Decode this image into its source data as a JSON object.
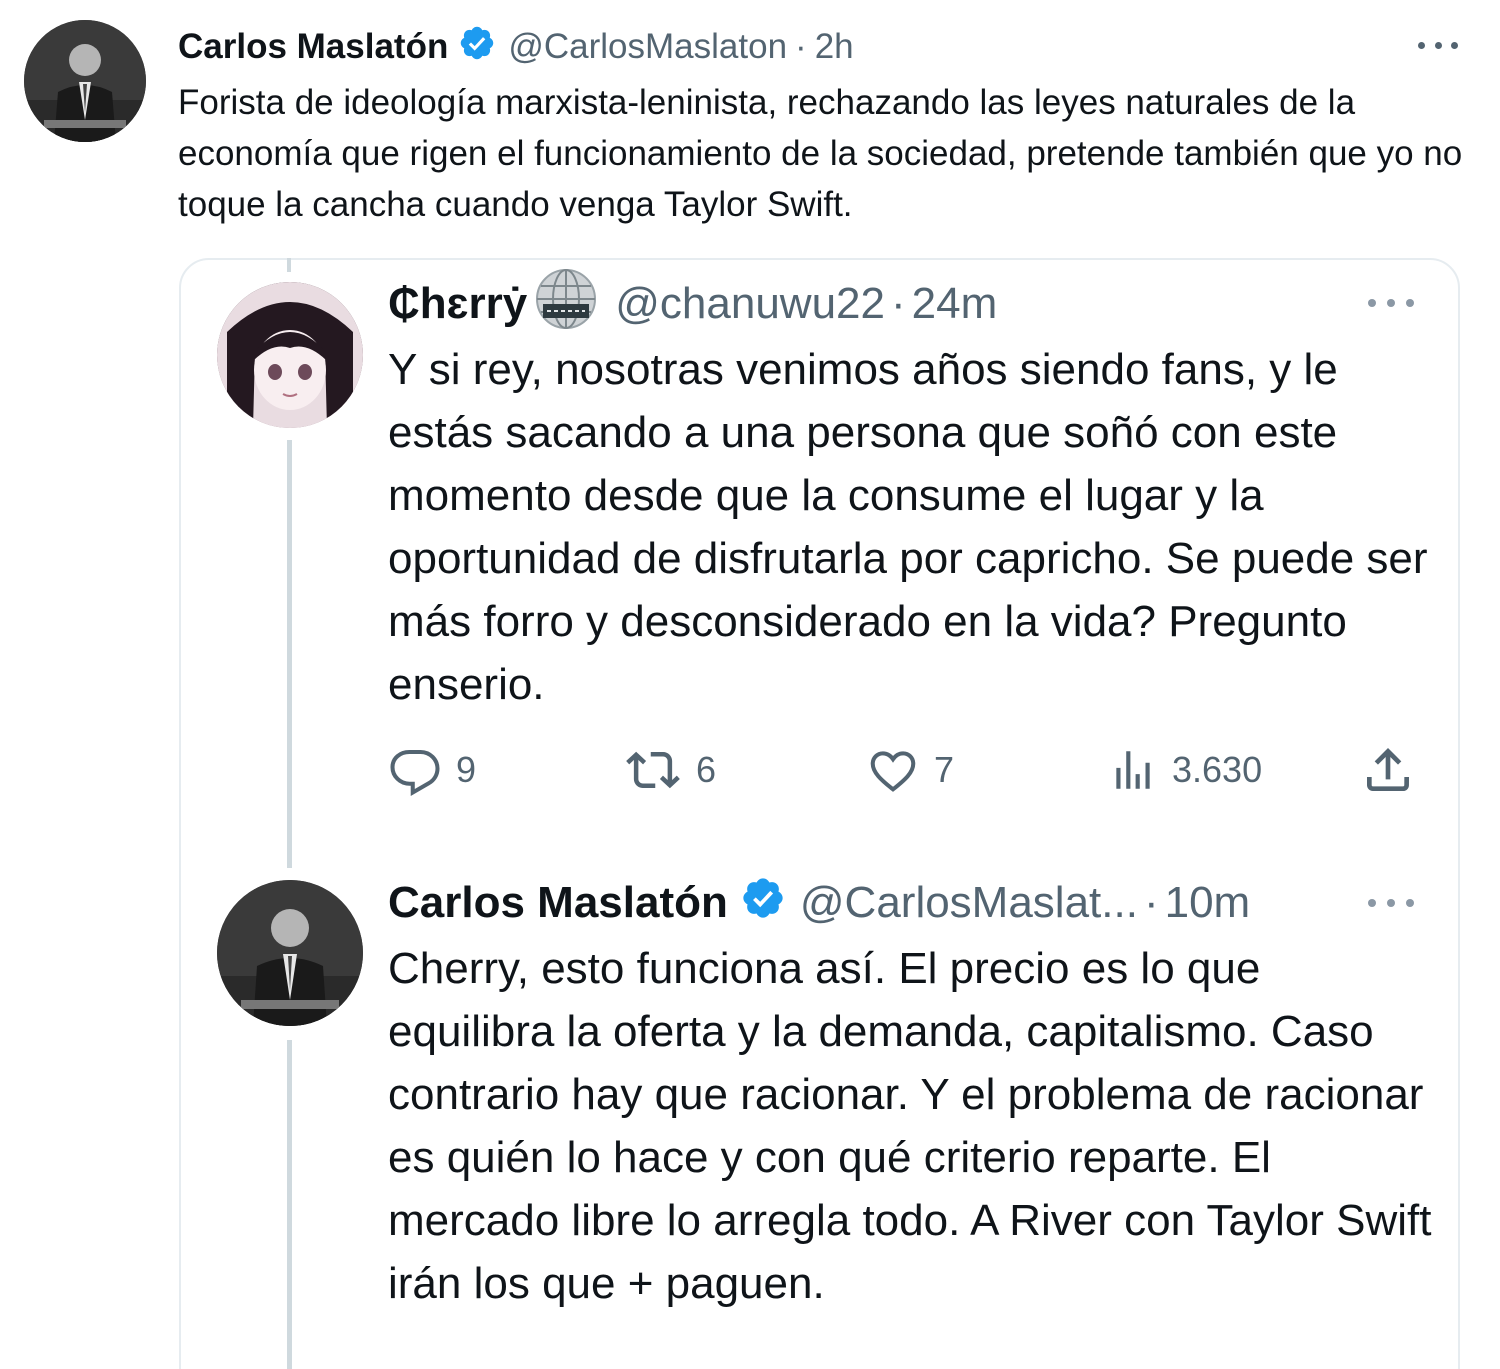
{
  "main_tweet": {
    "author_name": "Carlos Maslatón",
    "handle": "@CarlosMaslaton",
    "separator": "·",
    "time": "2h",
    "text": "Forista de ideología marxista-leninista, rechazando las leyes naturales de la economía que rigen el funcionamiento de la sociedad, pretende también que yo no toque la cancha cuando venga Taylor Swift."
  },
  "quoted_thread": {
    "first": {
      "author_name": "₵hɛrrẏ",
      "handle": "@chanuwu22",
      "separator": "·",
      "time": "24m",
      "text": "Y si rey, nosotras venimos años siendo fans, y le estás sacando a una persona que soñó con este momento desde que la consume el lugar y la oportunidad de disfrutarla por capricho. Se puede ser más forro y desconsiderado en la vida? Pregunto enserio.",
      "actions": {
        "replies": "9",
        "retweets": "6",
        "likes": "7",
        "views": "3.630"
      }
    },
    "reply": {
      "author_name": "Carlos Maslatón",
      "handle": "@CarlosMaslat...",
      "separator": "·",
      "time": "10m",
      "text": "Cherry, esto funciona así. El precio es lo que equilibra la oferta y la demanda, capitalismo. Caso contrario hay que racionar. Y el problema de racionar es quién lo hace y con qué criterio reparte. El mercado libre lo arregla todo. A River con Taylor Swift irán los que + paguen."
    }
  },
  "colors": {
    "verified": "#1d9bf0",
    "secondary_text": "#536471",
    "border": "#e6ecf0"
  },
  "icons": [
    "verified-icon",
    "more-icon",
    "globe-icon",
    "reply-icon",
    "retweet-icon",
    "like-icon",
    "views-icon",
    "share-icon"
  ]
}
